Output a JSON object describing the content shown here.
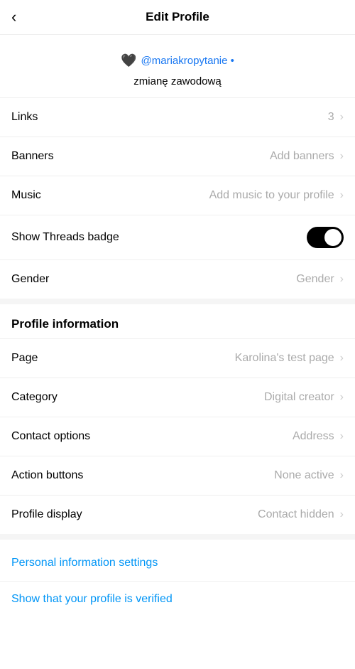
{
  "header": {
    "title": "Edit Profile",
    "back_icon": "‹"
  },
  "bio": {
    "emoji": "🖤",
    "mention": "@mariakropytanie",
    "suffix": " •",
    "second_line": "zmianę zawodową"
  },
  "rows": [
    {
      "label": "Links",
      "value": "3",
      "has_chevron": true
    },
    {
      "label": "Banners",
      "value": "Add banners",
      "has_chevron": true
    },
    {
      "label": "Music",
      "value": "Add music to your profile",
      "has_chevron": true
    },
    {
      "label": "Show Threads badge",
      "value": "",
      "has_toggle": true
    },
    {
      "label": "Gender",
      "value": "Gender",
      "has_chevron": true
    }
  ],
  "profile_information": {
    "heading": "Profile information",
    "rows": [
      {
        "label": "Page",
        "value": "Karolina's test page",
        "has_chevron": true
      },
      {
        "label": "Category",
        "value": "Digital creator",
        "has_chevron": true
      },
      {
        "label": "Contact options",
        "value": "Address",
        "has_chevron": true
      },
      {
        "label": "Action buttons",
        "value": "None active",
        "has_chevron": true
      },
      {
        "label": "Profile display",
        "value": "Contact hidden",
        "has_chevron": true
      }
    ]
  },
  "links": [
    {
      "label": "Personal information settings"
    },
    {
      "label": "Show that your profile is verified"
    }
  ],
  "chevron": "›"
}
